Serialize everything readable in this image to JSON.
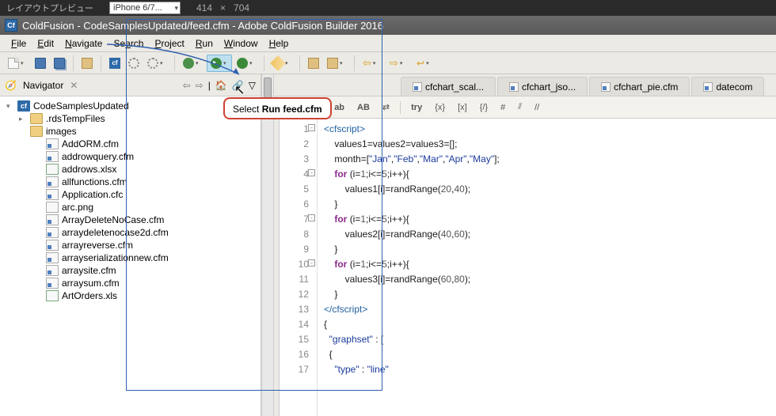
{
  "topbar": {
    "layout_label": "レイアウトプレビュー",
    "device": "iPhone 6/7...",
    "width": "414",
    "height": "704"
  },
  "title": "ColdFusion - CodeSamplesUpdated/feed.cfm - Adobe ColdFusion Builder 2016",
  "menu": {
    "file": "File",
    "edit": "Edit",
    "navigate": "Navigate",
    "search": "Search",
    "project": "Project",
    "run": "Run",
    "window": "Window",
    "help": "Help"
  },
  "tooltip": {
    "prefix": "Select ",
    "bold": "Run feed.cfm"
  },
  "navigator": {
    "title": "Navigator",
    "root": "CodeSamplesUpdated",
    "folders": [
      {
        "name": ".rdsTempFiles",
        "kind": "folder-closed"
      },
      {
        "name": "images",
        "kind": "folder"
      }
    ],
    "files": [
      "AddORM.cfm",
      "addrowquery.cfm",
      "addrows.xlsx",
      "allfunctions.cfm",
      "Application.cfc",
      "arc.png",
      "ArrayDeleteNoCase.cfm",
      "arraydeletenocase2d.cfm",
      "arrayreverse.cfm",
      "arrayserializationnew.cfm",
      "arraysite.cfm",
      "arraysum.cfm",
      "ArtOrders.xls"
    ]
  },
  "tabs": [
    {
      "label": "cfchart_scal..."
    },
    {
      "label": "cfchart_jso..."
    },
    {
      "label": "cfchart_pie.cfm"
    },
    {
      "label": "datecom"
    }
  ],
  "edtoolbar": {
    "q1": "“",
    "q2": "‘",
    "comma": ",",
    "ab": "ab",
    "AB": "AB",
    "swap": "⇄",
    "sep": "|",
    "try": "try",
    "br1": "{x}",
    "br2": "[x]",
    "br3": "{/}",
    "hash": "#",
    "sl1": "⫽",
    "sl2": "//"
  },
  "code": {
    "lines": [
      {
        "n": 1,
        "fold": "-",
        "html": "<span class='tok-tag'>&lt;cfscript&gt;</span>"
      },
      {
        "n": 2,
        "html": "    <span class='tok-plain'>values1=values2=values3=[];</span>"
      },
      {
        "n": 3,
        "html": "    <span class='tok-plain'>month=[</span><span class='tok-str'>\"Jan\"</span>,<span class='tok-str'>\"Feb\"</span>,<span class='tok-str'>\"Mar\"</span>,<span class='tok-str'>\"Apr\"</span>,<span class='tok-str'>\"May\"</span><span class='tok-plain'>];</span>"
      },
      {
        "n": 4,
        "fold": "-",
        "html": "    <span class='tok-key'>for</span> <span class='tok-plain'>(i=</span><span class='tok-num'>1</span><span class='tok-plain'>;i&lt;=</span><span class='tok-num'>5</span><span class='tok-plain'>;i++){</span>"
      },
      {
        "n": 5,
        "html": "        <span class='tok-plain'>values1[i]=randRange(</span><span class='tok-num'>20</span>,<span class='tok-num'>40</span><span class='tok-plain'>);</span>"
      },
      {
        "n": 6,
        "html": "    <span class='tok-plain'>}</span>"
      },
      {
        "n": 7,
        "fold": "-",
        "html": "    <span class='tok-key'>for</span> <span class='tok-plain'>(i=</span><span class='tok-num'>1</span><span class='tok-plain'>;i&lt;=</span><span class='tok-num'>5</span><span class='tok-plain'>;i++){</span>"
      },
      {
        "n": 8,
        "html": "        <span class='tok-plain'>values2[i]=randRange(</span><span class='tok-num'>40</span>,<span class='tok-num'>60</span><span class='tok-plain'>);</span>"
      },
      {
        "n": 9,
        "html": "    <span class='tok-plain'>}</span>"
      },
      {
        "n": 10,
        "fold": "-",
        "html": "    <span class='tok-key'>for</span> <span class='tok-plain'>(i=</span><span class='tok-num'>1</span><span class='tok-plain'>;i&lt;=</span><span class='tok-num'>5</span><span class='tok-plain'>;i++){</span>"
      },
      {
        "n": 11,
        "html": "        <span class='tok-plain'>values3[i]=randRange(</span><span class='tok-num'>60</span>,<span class='tok-num'>80</span><span class='tok-plain'>);</span>"
      },
      {
        "n": 12,
        "html": "    <span class='tok-plain'>}</span>"
      },
      {
        "n": 13,
        "html": "<span class='tok-tag'>&lt;/cfscript&gt;</span>"
      },
      {
        "n": 14,
        "html": "<span class='tok-plain'>{</span>"
      },
      {
        "n": 15,
        "html": "  <span class='tok-str'>\"graphset\"</span> <span class='tok-plain'>: [</span>"
      },
      {
        "n": 16,
        "html": "  <span class='tok-plain'>{</span>"
      },
      {
        "n": 17,
        "html": "    <span class='tok-str'>\"type\"</span> <span class='tok-plain'>:</span> <span class='tok-str'>\"line\"</span>"
      }
    ]
  }
}
